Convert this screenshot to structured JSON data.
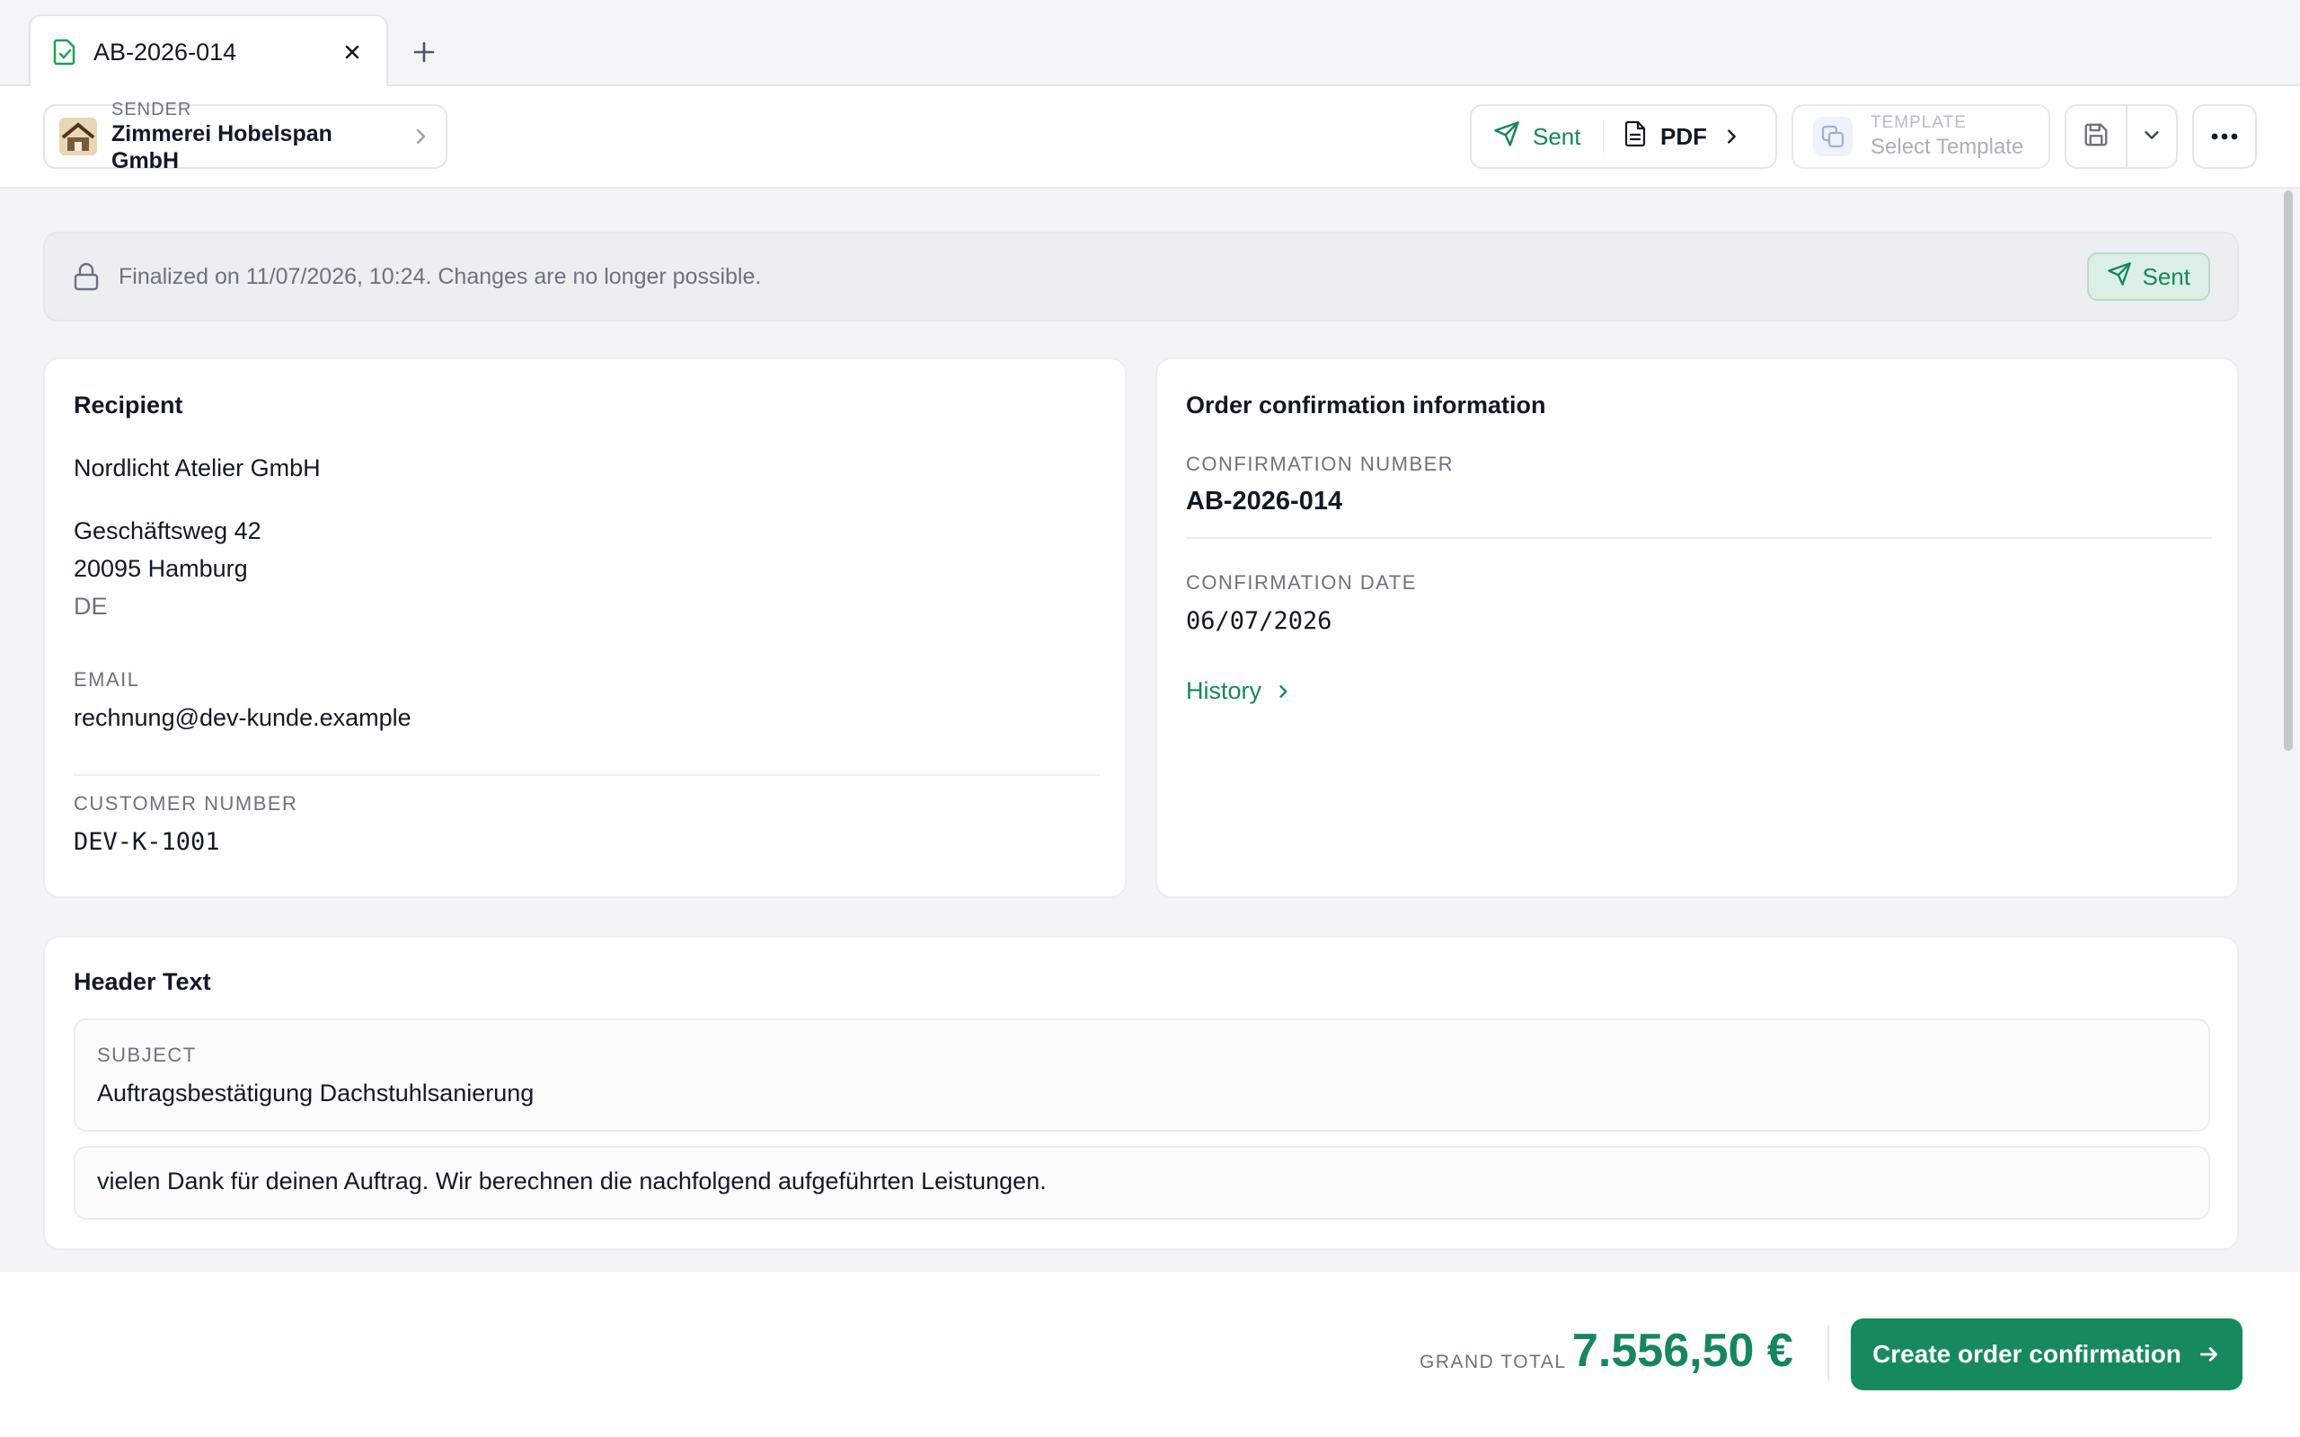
{
  "tab": {
    "label": "AB-2026-014"
  },
  "toolbar": {
    "sender_caption": "SENDER",
    "sender_name": "Zimmerei Hobelspan GmbH",
    "sent_label": "Sent",
    "pdf_label": "PDF",
    "template_caption": "TEMPLATE",
    "template_value": "Select Template"
  },
  "banner": {
    "text": "Finalized on 11/07/2026, 10:24. Changes are no longer possible.",
    "badge": "Sent"
  },
  "recipient": {
    "title": "Recipient",
    "company": "Nordlicht Atelier GmbH",
    "street": "Geschäftsweg 42",
    "city": "20095 Hamburg",
    "country": "DE",
    "email_caption": "EMAIL",
    "email": "rechnung@dev-kunde.example",
    "customer_number_caption": "CUSTOMER NUMBER",
    "customer_number": "DEV-K-1001"
  },
  "order_info": {
    "title": "Order confirmation information",
    "number_caption": "CONFIRMATION NUMBER",
    "number": "AB-2026-014",
    "date_caption": "CONFIRMATION DATE",
    "date": "06/07/2026",
    "history_link": "History"
  },
  "header_text": {
    "title": "Header Text",
    "subject_caption": "SUBJECT",
    "subject": "Auftragsbestätigung Dachstuhlsanierung",
    "body": "vielen Dank für deinen Auftrag. Wir berechnen die nachfolgend aufgeführten Leistungen."
  },
  "footer": {
    "grand_total_caption": "GRAND TOTAL",
    "grand_total": "7.556,50 €",
    "create_button": "Create order confirmation"
  },
  "colors": {
    "accent": "#168a5c",
    "accent_text": "#16875a",
    "background": "#f3f4f6"
  },
  "icons": [
    "document-check-icon",
    "close-icon",
    "plus-icon",
    "building-logo",
    "chevron-right-icon",
    "send-icon",
    "pdf-document-icon",
    "template-copy-icon",
    "save-icon",
    "chevron-down-icon",
    "more-icon",
    "lock-icon",
    "arrow-right-icon"
  ]
}
